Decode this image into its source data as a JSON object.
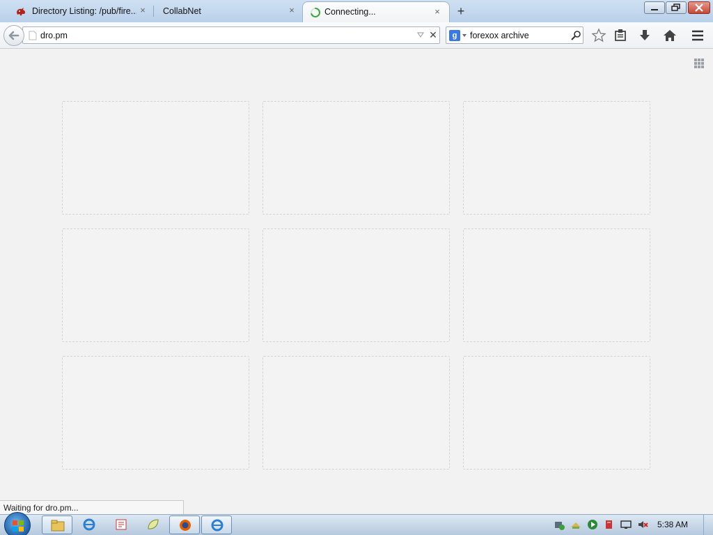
{
  "tabs": [
    {
      "label": "Directory Listing: /pub/fire...",
      "close": "×"
    },
    {
      "label": "CollabNet",
      "close": "×"
    },
    {
      "label": "Connecting...",
      "close": "×"
    }
  ],
  "new_tab": "+",
  "urlbar": {
    "value": "dro.pm",
    "stop": "✕"
  },
  "searchbar": {
    "engine": "g",
    "value": "forexox archive"
  },
  "status": {
    "text": "Waiting for dro.pm..."
  },
  "taskbar": {
    "clock": "5:38 AM"
  },
  "colors": {
    "tab_strip": "#c4d8ee",
    "active_tab": "#f6f8fa",
    "content_bg": "#f2f2f2",
    "thumb_border": "#d4d4d4",
    "taskbar": "#c8d8ea"
  },
  "icons": {
    "tab1": "red-dragon-favicon",
    "tab3": "loading-throbber",
    "toolbar": [
      "star-icon",
      "library-icon",
      "download-icon",
      "home-icon",
      "menu-icon"
    ]
  },
  "thumbnails_count": 9
}
